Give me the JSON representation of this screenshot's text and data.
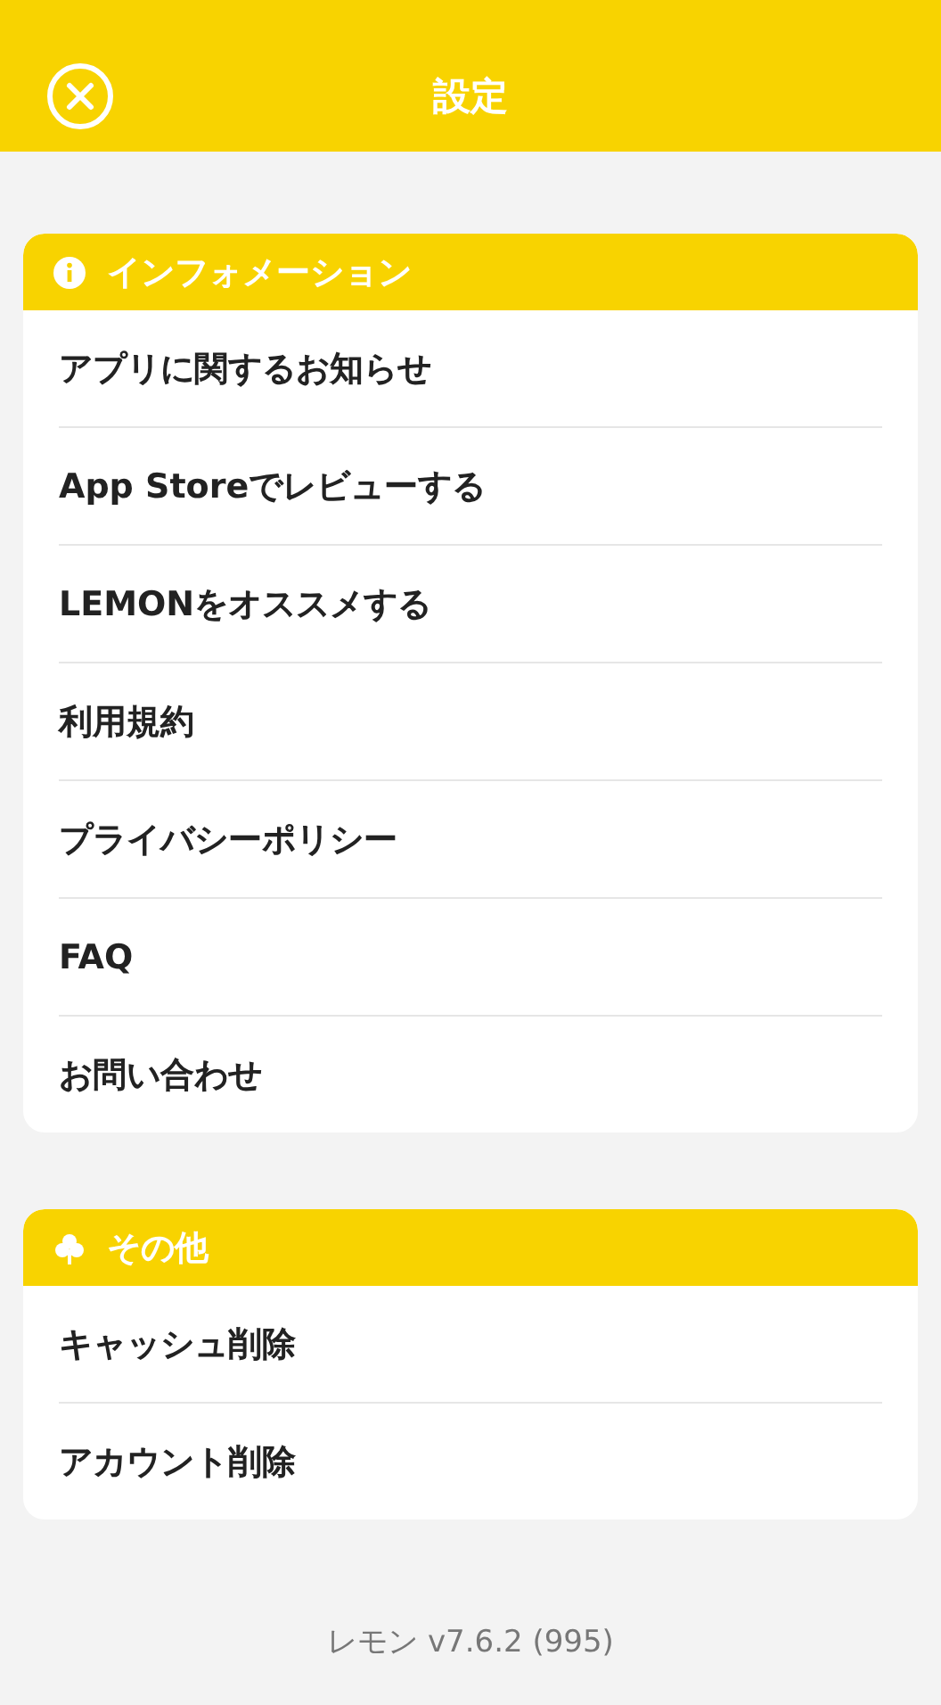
{
  "header": {
    "title": "設定"
  },
  "sections": [
    {
      "kind": "info",
      "title": "インフォメーション",
      "items": [
        "アプリに関するお知らせ",
        "App Storeでレビューする",
        "LEMONをオススメする",
        "利用規約",
        "プライバシーポリシー",
        "FAQ",
        "お問い合わせ"
      ]
    },
    {
      "kind": "club",
      "title": "その他",
      "items": [
        "キャッシュ削除",
        "アカウント削除"
      ]
    }
  ],
  "footer": {
    "version": "レモン v7.6.2 (995)"
  }
}
